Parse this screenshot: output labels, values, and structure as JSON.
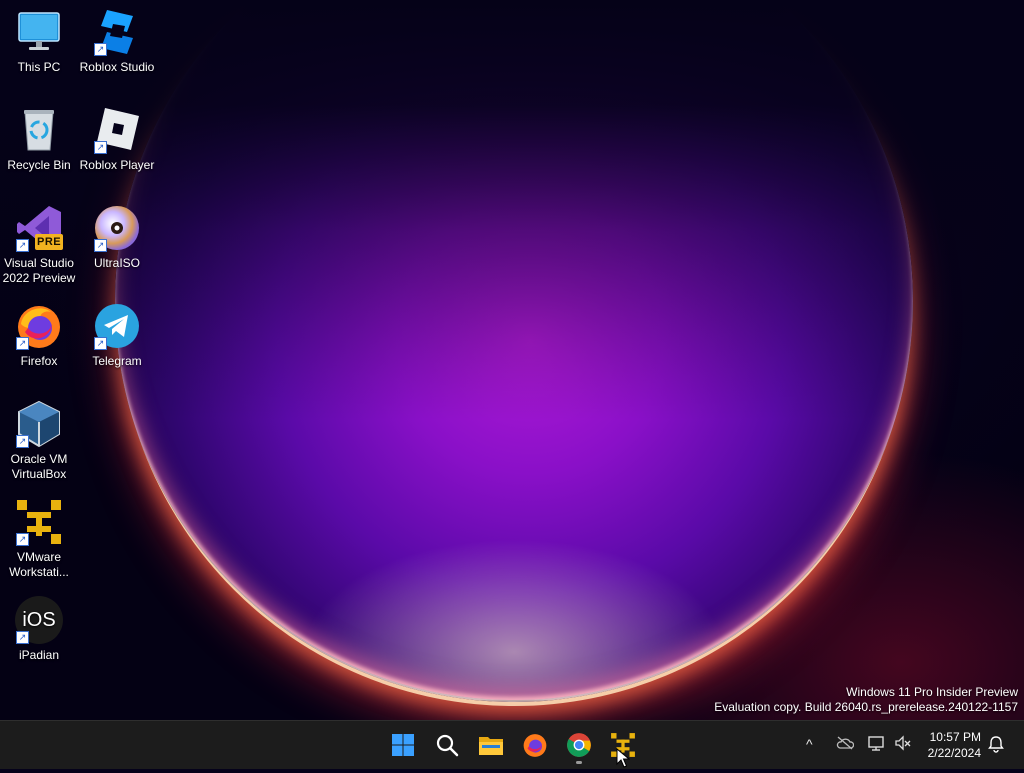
{
  "desktop": {
    "icons": [
      {
        "label": "This PC",
        "icon": "monitor-icon"
      },
      {
        "label": "Roblox Studio",
        "icon": "roblox-studio-icon"
      },
      {
        "label": "Recycle Bin",
        "icon": "recycle-bin-icon"
      },
      {
        "label": "Roblox Player",
        "icon": "roblox-player-icon"
      },
      {
        "label": "Visual Studio 2022 Preview",
        "line1": "Visual Studio",
        "line2": "2022 Preview",
        "badge": "PRE",
        "icon": "visual-studio-icon"
      },
      {
        "label": "UltraISO",
        "icon": "ultraiso-disc-icon"
      },
      {
        "label": "Firefox",
        "icon": "firefox-icon"
      },
      {
        "label": "Telegram",
        "icon": "telegram-icon"
      },
      {
        "label": "Oracle VM VirtualBox",
        "line1": "Oracle VM",
        "line2": "VirtualBox",
        "icon": "virtualbox-icon"
      },
      {
        "label": "VMware Workstation",
        "line1": "VMware",
        "line2": "Workstati...",
        "icon": "vmware-icon"
      },
      {
        "label": "iPadian",
        "badge": "iOS",
        "icon": "ipadian-icon"
      }
    ]
  },
  "watermark": {
    "line1": "Windows 11 Pro Insider Preview",
    "line2": "Evaluation copy. Build 26040.rs_prerelease.240122-1157"
  },
  "taskbar": {
    "apps": [
      {
        "name": "Start",
        "icon": "windows-start-icon"
      },
      {
        "name": "Search",
        "icon": "search-icon"
      },
      {
        "name": "File Explorer",
        "icon": "folder-icon"
      },
      {
        "name": "Firefox",
        "icon": "firefox-icon"
      },
      {
        "name": "Google Chrome",
        "icon": "chrome-icon",
        "running": true
      },
      {
        "name": "VMware Workstation",
        "icon": "vmware-icon"
      }
    ],
    "tray": {
      "chevron": "^",
      "icons": [
        "onedrive-offline-icon",
        "network-icon",
        "volume-muted-icon"
      ]
    },
    "clock": {
      "time": "10:57 PM",
      "date": "2/22/2024"
    }
  },
  "colors": {
    "taskbar": "#1c1c1c",
    "orb_core": "#b01ad6",
    "orb_rim": "#ff6a4a",
    "windows_blue": "#3aa0ff",
    "vmware_yellow": "#e8b20e"
  }
}
